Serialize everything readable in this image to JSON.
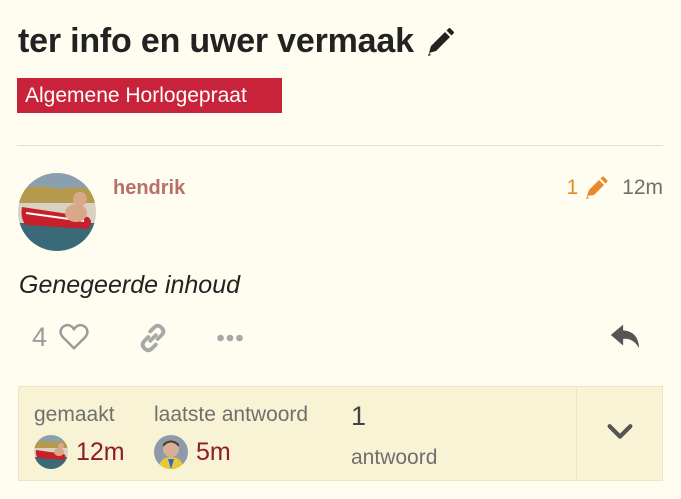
{
  "topic": {
    "title": "ter info en uwer vermaak",
    "category": "Algemene Horlogepraat",
    "category_color": "#c8233a"
  },
  "post": {
    "username": "hendrik",
    "edit_count": "1",
    "age": "12m",
    "body": "Genegeerde inhoud",
    "like_count": "4"
  },
  "summary": {
    "created_label": "gemaakt",
    "created_age": "12m",
    "last_reply_label": "laatste antwoord",
    "last_reply_age": "5m",
    "replies_count": "1",
    "replies_label": "antwoord"
  },
  "icons": {
    "title_edit": "pencil-icon",
    "edit_indicator": "pencil-icon",
    "like": "heart-icon",
    "link": "link-icon",
    "more": "ellipsis-icon",
    "reply": "reply-icon",
    "expand": "chevron-down-icon"
  },
  "colors": {
    "background": "#fefdf0",
    "username": "#b86f6a",
    "edit_indicator": "#e8892a",
    "time_link": "#8e1b26",
    "summary_bg": "#f8f3d4"
  }
}
